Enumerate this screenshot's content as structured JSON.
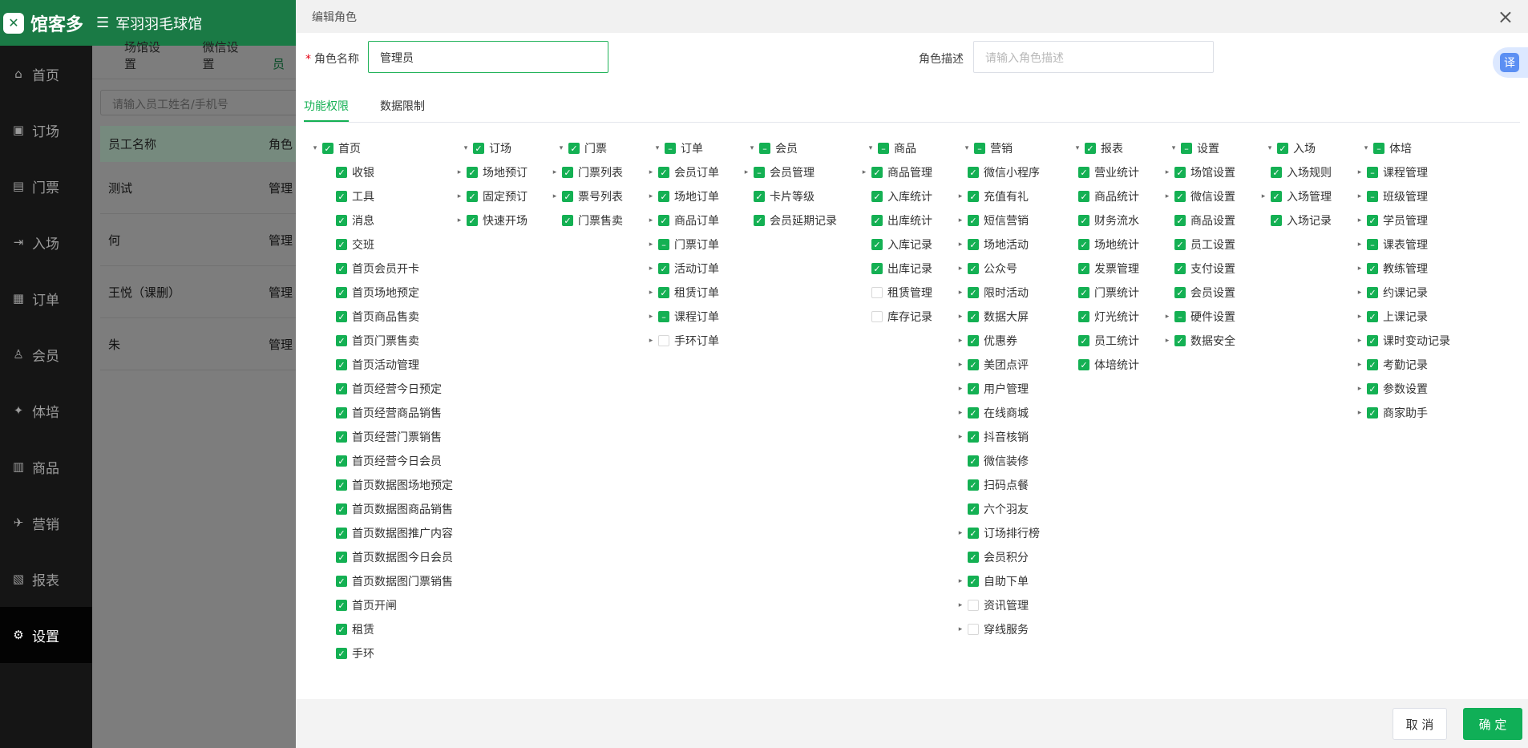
{
  "brand": {
    "logo": "馆客多",
    "venue": "军羽羽毛球馆",
    "menu_icon": "fold-menu-icon",
    "accent": "#14b053"
  },
  "sidebar": {
    "items": [
      {
        "label": "首页",
        "icon": "home-icon"
      },
      {
        "label": "订场",
        "icon": "booking-icon"
      },
      {
        "label": "门票",
        "icon": "ticket-icon"
      },
      {
        "label": "入场",
        "icon": "entry-icon"
      },
      {
        "label": "订单",
        "icon": "order-icon"
      },
      {
        "label": "会员",
        "icon": "member-icon"
      },
      {
        "label": "体培",
        "icon": "training-icon"
      },
      {
        "label": "商品",
        "icon": "goods-icon"
      },
      {
        "label": "营销",
        "icon": "marketing-icon"
      },
      {
        "label": "报表",
        "icon": "report-icon"
      },
      {
        "label": "设置",
        "icon": "gear-icon",
        "active": true
      }
    ]
  },
  "page": {
    "tabs": [
      "场馆设置",
      "微信设置",
      "员"
    ],
    "search_placeholder": "请输入员工姓名/手机号",
    "table": {
      "headers": [
        "员工名称",
        "角色"
      ],
      "rows": [
        [
          "测试",
          "管理"
        ],
        [
          "何",
          "管理"
        ],
        [
          "王悦（课删）",
          "管理"
        ],
        [
          "朱",
          "管理"
        ]
      ]
    }
  },
  "modal": {
    "title": "编辑角色",
    "close_icon": "close-icon",
    "role_name_label": "角色名称",
    "role_name_value": "管理员",
    "role_desc_label": "角色描述",
    "role_desc_placeholder": "请输入角色描述",
    "translate_label": "译",
    "tabs": [
      "功能权限",
      "数据限制"
    ],
    "cancel": "取 消",
    "confirm": "确 定"
  },
  "permissions": [
    {
      "label": "首页",
      "state": "checked",
      "items": [
        {
          "label": "收银",
          "state": "checked"
        },
        {
          "label": "工具",
          "state": "checked"
        },
        {
          "label": "消息",
          "state": "checked"
        },
        {
          "label": "交班",
          "state": "checked"
        },
        {
          "label": "首页会员开卡",
          "state": "checked"
        },
        {
          "label": "首页场地预定",
          "state": "checked"
        },
        {
          "label": "首页商品售卖",
          "state": "checked"
        },
        {
          "label": "首页门票售卖",
          "state": "checked"
        },
        {
          "label": "首页活动管理",
          "state": "checked"
        },
        {
          "label": "首页经营今日预定",
          "state": "checked"
        },
        {
          "label": "首页经营商品销售",
          "state": "checked"
        },
        {
          "label": "首页经营门票销售",
          "state": "checked"
        },
        {
          "label": "首页经营今日会员",
          "state": "checked"
        },
        {
          "label": "首页数据图场地预定",
          "state": "checked"
        },
        {
          "label": "首页数据图商品销售",
          "state": "checked"
        },
        {
          "label": "首页数据图推广内容",
          "state": "checked"
        },
        {
          "label": "首页数据图今日会员",
          "state": "checked"
        },
        {
          "label": "首页数据图门票销售",
          "state": "checked"
        },
        {
          "label": "首页开闸",
          "state": "checked"
        },
        {
          "label": "租赁",
          "state": "checked"
        },
        {
          "label": "手环",
          "state": "checked"
        }
      ]
    },
    {
      "label": "订场",
      "state": "checked",
      "items": [
        {
          "label": "场地预订",
          "state": "checked",
          "arrow": true
        },
        {
          "label": "固定预订",
          "state": "checked",
          "arrow": true
        },
        {
          "label": "快速开场",
          "state": "checked",
          "arrow": true
        }
      ]
    },
    {
      "label": "门票",
      "state": "checked",
      "items": [
        {
          "label": "门票列表",
          "state": "checked",
          "arrow": true
        },
        {
          "label": "票号列表",
          "state": "checked",
          "arrow": true
        },
        {
          "label": "门票售卖",
          "state": "checked"
        }
      ]
    },
    {
      "label": "订单",
      "state": "partial",
      "items": [
        {
          "label": "会员订单",
          "state": "checked",
          "arrow": true
        },
        {
          "label": "场地订单",
          "state": "checked",
          "arrow": true
        },
        {
          "label": "商品订单",
          "state": "checked",
          "arrow": true
        },
        {
          "label": "门票订单",
          "state": "partial",
          "arrow": true
        },
        {
          "label": "活动订单",
          "state": "checked",
          "arrow": true
        },
        {
          "label": "租赁订单",
          "state": "checked",
          "arrow": true
        },
        {
          "label": "课程订单",
          "state": "partial",
          "arrow": true
        },
        {
          "label": "手环订单",
          "state": "unchecked",
          "arrow": true
        }
      ]
    },
    {
      "label": "会员",
      "state": "partial",
      "items": [
        {
          "label": "会员管理",
          "state": "partial",
          "arrow": true
        },
        {
          "label": "卡片等级",
          "state": "checked"
        },
        {
          "label": "会员延期记录",
          "state": "checked"
        }
      ]
    },
    {
      "label": "商品",
      "state": "partial",
      "items": [
        {
          "label": "商品管理",
          "state": "checked",
          "arrow": true
        },
        {
          "label": "入库统计",
          "state": "checked"
        },
        {
          "label": "出库统计",
          "state": "checked"
        },
        {
          "label": "入库记录",
          "state": "checked"
        },
        {
          "label": "出库记录",
          "state": "checked"
        },
        {
          "label": "租赁管理",
          "state": "unchecked"
        },
        {
          "label": "库存记录",
          "state": "unchecked"
        }
      ]
    },
    {
      "label": "营销",
      "state": "partial",
      "items": [
        {
          "label": "微信小程序",
          "state": "checked"
        },
        {
          "label": "充值有礼",
          "state": "checked",
          "arrow": true
        },
        {
          "label": "短信营销",
          "state": "checked",
          "arrow": true
        },
        {
          "label": "场地活动",
          "state": "checked",
          "arrow": true
        },
        {
          "label": "公众号",
          "state": "checked",
          "arrow": true
        },
        {
          "label": "限时活动",
          "state": "checked",
          "arrow": true
        },
        {
          "label": "数据大屏",
          "state": "checked",
          "arrow": true
        },
        {
          "label": "优惠券",
          "state": "checked",
          "arrow": true
        },
        {
          "label": "美团点评",
          "state": "checked",
          "arrow": true
        },
        {
          "label": "用户管理",
          "state": "checked",
          "arrow": true
        },
        {
          "label": "在线商城",
          "state": "checked",
          "arrow": true
        },
        {
          "label": "抖音核销",
          "state": "checked",
          "arrow": true
        },
        {
          "label": "微信装修",
          "state": "checked"
        },
        {
          "label": "扫码点餐",
          "state": "checked"
        },
        {
          "label": "六个羽友",
          "state": "checked"
        },
        {
          "label": "订场排行榜",
          "state": "checked",
          "arrow": true
        },
        {
          "label": "会员积分",
          "state": "checked"
        },
        {
          "label": "自助下单",
          "state": "checked",
          "arrow": true
        },
        {
          "label": "资讯管理",
          "state": "unchecked",
          "arrow": true
        },
        {
          "label": "穿线服务",
          "state": "unchecked",
          "arrow": true
        }
      ]
    },
    {
      "label": "报表",
      "state": "checked",
      "items": [
        {
          "label": "营业统计",
          "state": "checked"
        },
        {
          "label": "商品统计",
          "state": "checked"
        },
        {
          "label": "财务流水",
          "state": "checked"
        },
        {
          "label": "场地统计",
          "state": "checked"
        },
        {
          "label": "发票管理",
          "state": "checked"
        },
        {
          "label": "门票统计",
          "state": "checked"
        },
        {
          "label": "灯光统计",
          "state": "checked"
        },
        {
          "label": "员工统计",
          "state": "checked"
        },
        {
          "label": "体培统计",
          "state": "checked"
        }
      ]
    },
    {
      "label": "设置",
      "state": "partial",
      "items": [
        {
          "label": "场馆设置",
          "state": "checked",
          "arrow": true
        },
        {
          "label": "微信设置",
          "state": "checked",
          "arrow": true
        },
        {
          "label": "商品设置",
          "state": "checked"
        },
        {
          "label": "员工设置",
          "state": "checked"
        },
        {
          "label": "支付设置",
          "state": "checked"
        },
        {
          "label": "会员设置",
          "state": "checked"
        },
        {
          "label": "硬件设置",
          "state": "partial",
          "arrow": true
        },
        {
          "label": "数据安全",
          "state": "checked",
          "arrow": true
        }
      ]
    },
    {
      "label": "入场",
      "state": "checked",
      "items": [
        {
          "label": "入场规则",
          "state": "checked"
        },
        {
          "label": "入场管理",
          "state": "checked",
          "arrow": true
        },
        {
          "label": "入场记录",
          "state": "checked"
        }
      ]
    },
    {
      "label": "体培",
      "state": "partial",
      "items": [
        {
          "label": "课程管理",
          "state": "partial",
          "arrow": true
        },
        {
          "label": "班级管理",
          "state": "partial",
          "arrow": true
        },
        {
          "label": "学员管理",
          "state": "checked",
          "arrow": true
        },
        {
          "label": "课表管理",
          "state": "partial",
          "arrow": true
        },
        {
          "label": "教练管理",
          "state": "checked",
          "arrow": true
        },
        {
          "label": "约课记录",
          "state": "checked",
          "arrow": true
        },
        {
          "label": "上课记录",
          "state": "checked",
          "arrow": true
        },
        {
          "label": "课时变动记录",
          "state": "checked",
          "arrow": true
        },
        {
          "label": "考勤记录",
          "state": "checked",
          "arrow": true
        },
        {
          "label": "参数设置",
          "state": "checked",
          "arrow": true
        },
        {
          "label": "商家助手",
          "state": "checked",
          "arrow": true
        }
      ]
    }
  ]
}
